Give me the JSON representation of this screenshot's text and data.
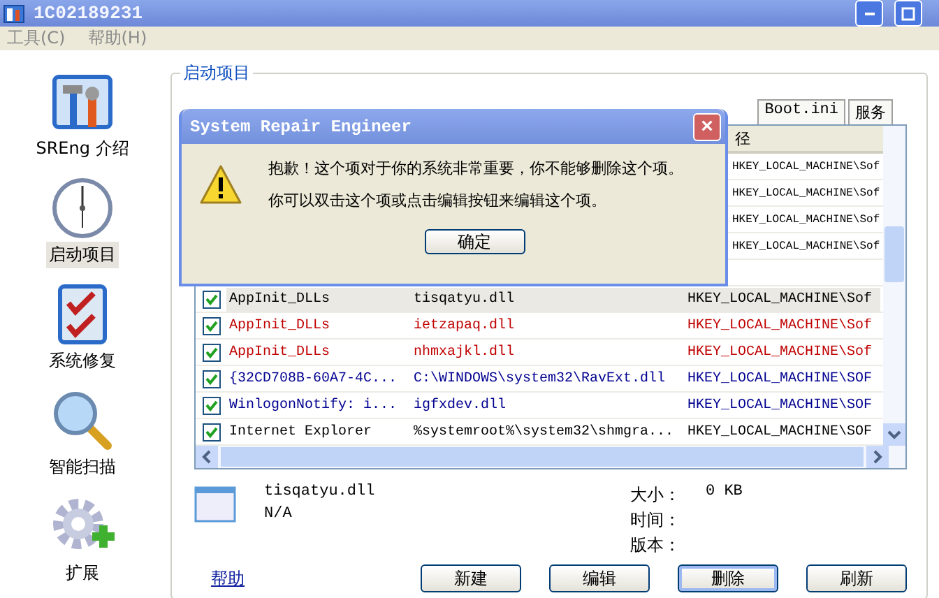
{
  "window": {
    "title": "1C02189231"
  },
  "menu": [
    {
      "label": "工具(C)",
      "disabled": true
    },
    {
      "label": "帮助(H)",
      "disabled": true
    }
  ],
  "sidebar": {
    "items": [
      {
        "label": "SREng 介绍",
        "kind": "tools",
        "selected": false
      },
      {
        "label": "启动项目",
        "kind": "clock",
        "selected": true
      },
      {
        "label": "系统修复",
        "kind": "checklist",
        "selected": false
      },
      {
        "label": "智能扫描",
        "kind": "magnifier",
        "selected": false
      },
      {
        "label": "扩展",
        "kind": "gear",
        "selected": false
      }
    ]
  },
  "group": {
    "title": "启动项目"
  },
  "tabs": [
    {
      "label": "Boot.ini",
      "selected": false
    },
    {
      "label": "服务",
      "selected": false
    }
  ],
  "table": {
    "columns": [
      "",
      "",
      "径"
    ],
    "covered_rows": [
      {
        "column_3": "HKEY_LOCAL_MACHINE\\Sof"
      },
      {
        "column_3": "HKEY_LOCAL_MACHINE\\Sof"
      },
      {
        "column_3": "HKEY_LOCAL_MACHINE\\Sof"
      },
      {
        "column_3": "HKEY_LOCAL_MACHINE\\Sof"
      }
    ],
    "rows": [
      {
        "checked": true,
        "selected": true,
        "color": "#000000",
        "cells": [
          "AppInit_DLLs",
          "tisqatyu.dll",
          "HKEY_LOCAL_MACHINE\\Sof"
        ]
      },
      {
        "checked": true,
        "selected": false,
        "color": "#c00000",
        "cells": [
          "AppInit_DLLs",
          "ietzapaq.dll",
          "HKEY_LOCAL_MACHINE\\Sof"
        ]
      },
      {
        "checked": true,
        "selected": false,
        "color": "#c00000",
        "cells": [
          "AppInit_DLLs",
          "nhmxajkl.dll",
          "HKEY_LOCAL_MACHINE\\Sof"
        ]
      },
      {
        "checked": true,
        "selected": false,
        "color": "#000090",
        "cells": [
          "{32CD708B-60A7-4C...",
          "C:\\WINDOWS\\system32\\RavExt.dll",
          "HKEY_LOCAL_MACHINE\\SOF"
        ]
      },
      {
        "checked": true,
        "selected": false,
        "color": "#000090",
        "cells": [
          "WinlogonNotify: i...",
          "igfxdev.dll",
          "HKEY_LOCAL_MACHINE\\SOF"
        ]
      },
      {
        "checked": true,
        "selected": false,
        "color": "#000000",
        "cells": [
          "Internet Explorer",
          "%systemroot%\\system32\\shmgra...",
          "HKEY_LOCAL_MACHINE\\SOF"
        ]
      }
    ]
  },
  "details": {
    "file": "tisqatyu.dll",
    "company": "N/A",
    "fields": [
      {
        "label": "大小：",
        "value": "0 KB"
      },
      {
        "label": "时间："
      },
      {
        "label": "版本："
      }
    ]
  },
  "help_link": "帮助",
  "buttons": [
    {
      "label": "新建",
      "focused": false
    },
    {
      "label": "编辑",
      "focused": false
    },
    {
      "label": "删除",
      "focused": true
    },
    {
      "label": "刷新",
      "focused": false
    }
  ],
  "dialog": {
    "title": "System Repair Engineer",
    "close": "×",
    "lines": [
      "抱歉！这个项对于你的系统非常重要，你不能够删除这个项。",
      "你可以双击这个项或点击编辑按钮来编辑这个项。"
    ],
    "button": "确定"
  }
}
